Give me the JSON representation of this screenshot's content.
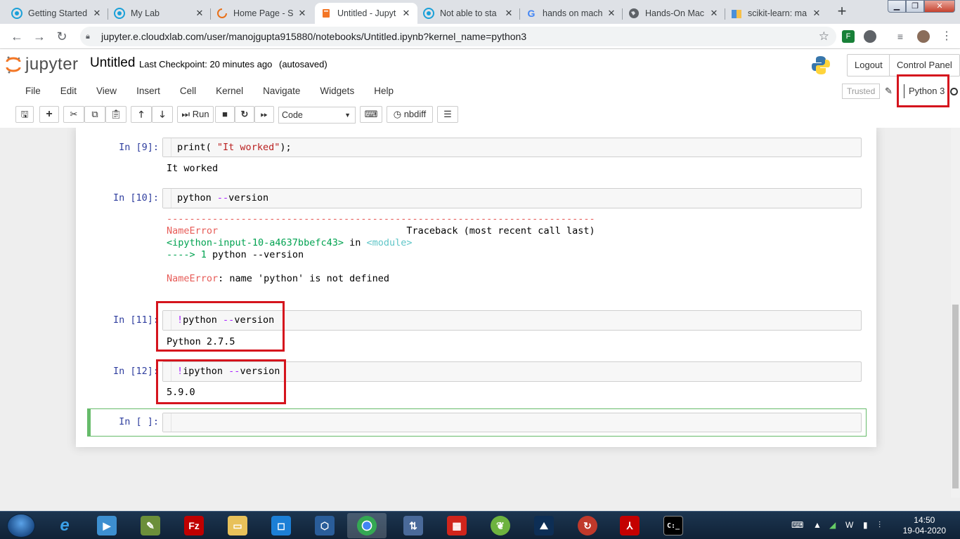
{
  "browser": {
    "tabs": [
      {
        "title": "Getting Started",
        "icon": "cloudx-icon",
        "active": false
      },
      {
        "title": "My Lab",
        "icon": "cloudx-icon",
        "active": false
      },
      {
        "title": "Home Page - S",
        "icon": "spinner-icon",
        "active": false
      },
      {
        "title": "Untitled - Jupyt",
        "icon": "notebook-icon",
        "active": true
      },
      {
        "title": "Not able to sta",
        "icon": "cloudx-icon",
        "active": false
      },
      {
        "title": "hands on mach",
        "icon": "google-icon",
        "active": false
      },
      {
        "title": "Hands-On Mac",
        "icon": "globe-icon",
        "active": false
      },
      {
        "title": "scikit-learn: ma",
        "icon": "bookmark-icon",
        "active": false
      }
    ],
    "url": "jupyter.e.cloudxlab.com/user/manojgupta915880/notebooks/Untitled.ipynb?kernel_name=python3"
  },
  "jupyter": {
    "logo_text": "jupyter",
    "notebook_name": "Untitled",
    "checkpoint": "Last Checkpoint: 20 minutes ago",
    "autosave": "(autosaved)",
    "logout": "Logout",
    "control_panel": "Control Panel",
    "menus": [
      "File",
      "Edit",
      "View",
      "Insert",
      "Cell",
      "Kernel",
      "Navigate",
      "Widgets",
      "Help"
    ],
    "trusted": "Trusted",
    "kernel_name": "Python 3",
    "toolbar": {
      "run": "Run",
      "cell_type": "Code",
      "nbdiff": "nbdiff"
    }
  },
  "cells": {
    "c9": {
      "prompt": "In [9]:",
      "code_fn": "print(",
      "code_str": "\"It worked\"",
      "code_end": ");",
      "output": "It worked"
    },
    "c10": {
      "prompt": "In [10]:",
      "code_a": "python ",
      "code_op": "--",
      "code_b": "version",
      "dashes": "---------------------------------------------------------------------------",
      "err_name": "NameError",
      "traceback": "Traceback (most recent call last)",
      "input_ref": "<ipython-input-10-a4637bbefc43>",
      "in_word": " in ",
      "module_ref": "<module>",
      "arrow": "----> 1 ",
      "arrow_code": "python --version",
      "err_msg": ": name 'python' is not defined"
    },
    "c11": {
      "prompt": "In [11]:",
      "bang": "!",
      "code_a": "python ",
      "code_op": "--",
      "code_b": "version",
      "output": "Python 2.7.5"
    },
    "c12": {
      "prompt": "In [12]:",
      "bang": "!",
      "code_a": "ipython ",
      "code_op": "--",
      "code_b": "version",
      "output": "5.9.0"
    },
    "empty": {
      "prompt": "In [ ]:"
    }
  },
  "taskbar": {
    "time": "14:50",
    "date": "19-04-2020"
  },
  "colors": {
    "highlight": "#d5141d",
    "prompt": "#303f9f",
    "string": "#ba2121",
    "operator": "#aa22ff",
    "error_red": "#e75c58"
  }
}
